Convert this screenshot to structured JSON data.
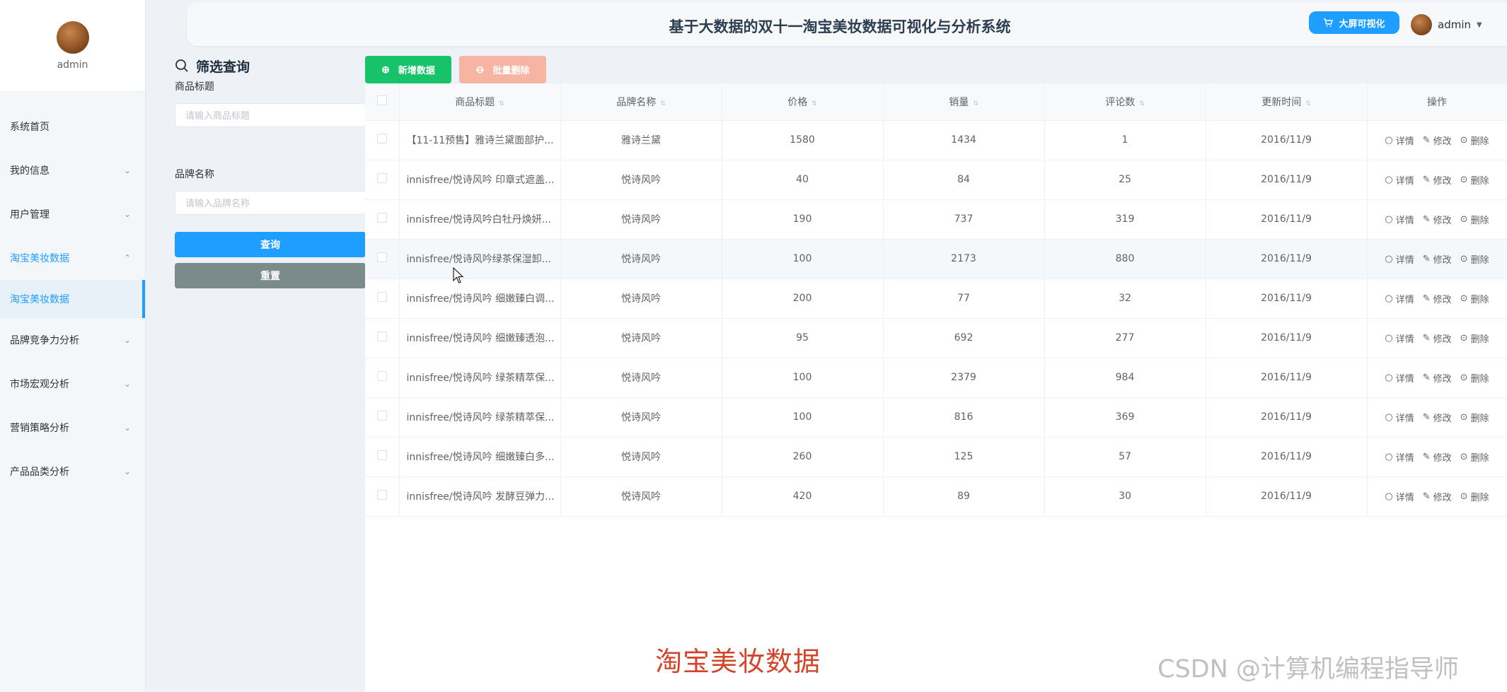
{
  "header": {
    "title": "基于大数据的双十一淘宝美妆数据可视化与分析系统",
    "big_screen_label": "大屏可视化",
    "username": "admin"
  },
  "sidebar": {
    "profile_name": "admin",
    "items": [
      {
        "label": "系统首页",
        "has_children": false
      },
      {
        "label": "我的信息",
        "has_children": true
      },
      {
        "label": "用户管理",
        "has_children": true
      },
      {
        "label": "淘宝美妆数据",
        "has_children": true,
        "open": true
      },
      {
        "label": "淘宝美妆数据",
        "sub": true,
        "active": true
      },
      {
        "label": "品牌竞争力分析",
        "has_children": true
      },
      {
        "label": "市场宏观分析",
        "has_children": true
      },
      {
        "label": "营销策略分析",
        "has_children": true
      },
      {
        "label": "产品品类分析",
        "has_children": true
      }
    ]
  },
  "filter": {
    "title": "筛选查询",
    "title_label": "商品标题",
    "title_placeholder": "请输入商品标题",
    "brand_label": "品牌名称",
    "brand_placeholder": "请输入品牌名称",
    "query_label": "查询",
    "reset_label": "重置"
  },
  "toolbar": {
    "add_label": "新增数据",
    "batch_delete_label": "批量删除"
  },
  "table": {
    "columns": [
      "商品标题",
      "品牌名称",
      "价格",
      "销量",
      "评论数",
      "更新时间",
      "操作"
    ],
    "actions": {
      "detail": "详情",
      "edit": "修改",
      "delete": "删除"
    },
    "rows": [
      [
        "【11-11预售】雅诗兰黛面部护...",
        "雅诗兰黛",
        "1580",
        "1434",
        "1",
        "2016/11/9"
      ],
      [
        "innisfree/悦诗风吟 印章式遮盖...",
        "悦诗风吟",
        "40",
        "84",
        "25",
        "2016/11/9"
      ],
      [
        "innisfree/悦诗风吟白牡丹焕妍...",
        "悦诗风吟",
        "190",
        "737",
        "319",
        "2016/11/9"
      ],
      [
        "innisfree/悦诗风吟绿茶保湿卸...",
        "悦诗风吟",
        "100",
        "2173",
        "880",
        "2016/11/9"
      ],
      [
        "innisfree/悦诗风吟 细嫩臻白调...",
        "悦诗风吟",
        "200",
        "77",
        "32",
        "2016/11/9"
      ],
      [
        "innisfree/悦诗风吟 细嫩臻透泡...",
        "悦诗风吟",
        "95",
        "692",
        "277",
        "2016/11/9"
      ],
      [
        "innisfree/悦诗风吟 绿茶精萃保...",
        "悦诗风吟",
        "100",
        "2379",
        "984",
        "2016/11/9"
      ],
      [
        "innisfree/悦诗风吟 绿茶精萃保...",
        "悦诗风吟",
        "100",
        "816",
        "369",
        "2016/11/9"
      ],
      [
        "innisfree/悦诗风吟 细嫩臻白多...",
        "悦诗风吟",
        "260",
        "125",
        "57",
        "2016/11/9"
      ],
      [
        "innisfree/悦诗风吟 发酵豆弹力...",
        "悦诗风吟",
        "420",
        "89",
        "30",
        "2016/11/9"
      ]
    ]
  },
  "caption": "淘宝美妆数据",
  "watermark": "CSDN @计算机编程指导师",
  "colors": {
    "primary": "#1e9fff",
    "add": "#17c36a",
    "batch_delete": "#f8b4a3",
    "reset": "#7b8a8b",
    "caption": "#d2452b"
  }
}
